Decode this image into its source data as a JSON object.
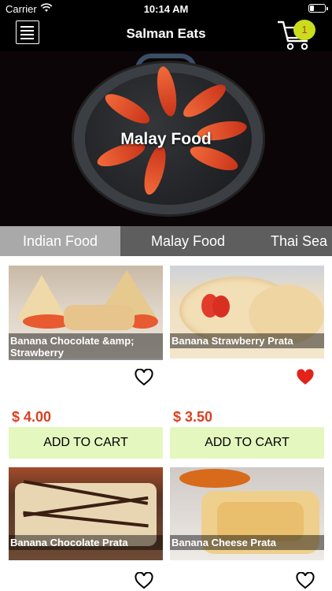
{
  "status_bar": {
    "carrier": "Carrier",
    "time": "10:14 AM"
  },
  "nav": {
    "title": "Salman Eats",
    "cart_count": "1"
  },
  "hero": {
    "label": "Malay Food"
  },
  "tabs": [
    {
      "label": "Indian Food",
      "active": true
    },
    {
      "label": "Malay Food",
      "active": false
    },
    {
      "label": "Thai Sea",
      "active": false
    }
  ],
  "products": [
    {
      "name": "Banana Chocolate &amp; Strawberry",
      "price": "$ 4.00",
      "add_label": "ADD TO CART",
      "favorite": false
    },
    {
      "name": "Banana Strawberry Prata",
      "price": "$ 3.50",
      "add_label": "ADD TO CART",
      "favorite": true
    },
    {
      "name": "Banana Chocolate Prata",
      "favorite": false
    },
    {
      "name": "Banana Cheese Prata",
      "favorite": false
    }
  ],
  "colors": {
    "accent_price": "#d94120",
    "add_button_bg": "#e4f7bf",
    "cart_badge": "#c9dd1c",
    "heart_active": "#e2231a"
  }
}
